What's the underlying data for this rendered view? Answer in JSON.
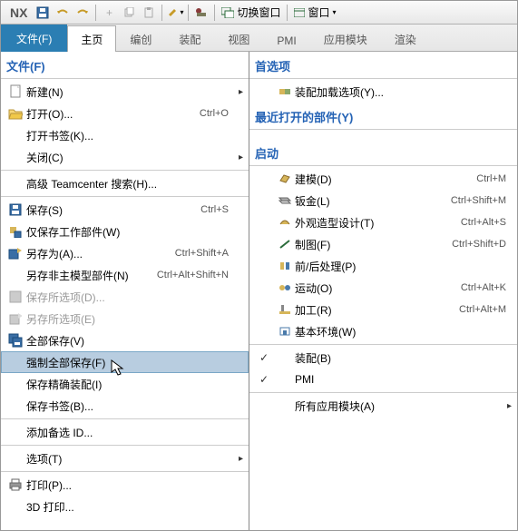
{
  "titlebar": {
    "logo": "NX",
    "switch_window": "切换窗口",
    "window_menu": "窗口"
  },
  "ribbon": {
    "file": "文件(F)",
    "home": "主页",
    "edit": "编创",
    "assembly": "装配",
    "view": "视图",
    "pmi": "PMI",
    "app": "应用模块",
    "render": "渲染"
  },
  "left_menu": {
    "title": "文件(F)",
    "new": "新建(N)",
    "open": "打开(O)...",
    "open_sc": "Ctrl+O",
    "open_bookmark": "打开书签(K)...",
    "close": "关闭(C)",
    "adv_tc_search": "高级 Teamcenter 搜索(H)...",
    "save": "保存(S)",
    "save_sc": "Ctrl+S",
    "save_work_only": "仅保存工作部件(W)",
    "save_as": "另存为(A)...",
    "save_as_sc": "Ctrl+Shift+A",
    "save_nonmaster": "另存非主模型部件(N)",
    "save_nonmaster_sc": "Ctrl+Alt+Shift+N",
    "save_selected": "保存所选项(D)...",
    "save_sel_alt": "另存所选项(E)",
    "save_all": "全部保存(V)",
    "force_save_all": "强制全部保存(F)",
    "save_precise_asm": "保存精确装配(I)",
    "save_bookmark": "保存书签(B)...",
    "add_remark_id": "添加备选 ID...",
    "options": "选项(T)",
    "print": "打印(P)...",
    "print_3d": "3D 打印..."
  },
  "right_menu": {
    "preferences": "首选项",
    "asm_load_opts": "装配加载选项(Y)...",
    "recent_parts": "最近打开的部件(Y)",
    "start": "启动",
    "modeling": "建模(D)",
    "modeling_sc": "Ctrl+M",
    "sheetmetal": "钣金(L)",
    "sheetmetal_sc": "Ctrl+Shift+M",
    "styling": "外观造型设计(T)",
    "styling_sc": "Ctrl+Alt+S",
    "drafting": "制图(F)",
    "drafting_sc": "Ctrl+Shift+D",
    "prepost": "前/后处理(P)",
    "motion": "运动(O)",
    "motion_sc": "Ctrl+Alt+K",
    "mfg": "加工(R)",
    "mfg_sc": "Ctrl+Alt+M",
    "gateway": "基本环境(W)",
    "assembly": "装配(B)",
    "pmi": "PMI",
    "all_apps": "所有应用模块(A)"
  }
}
